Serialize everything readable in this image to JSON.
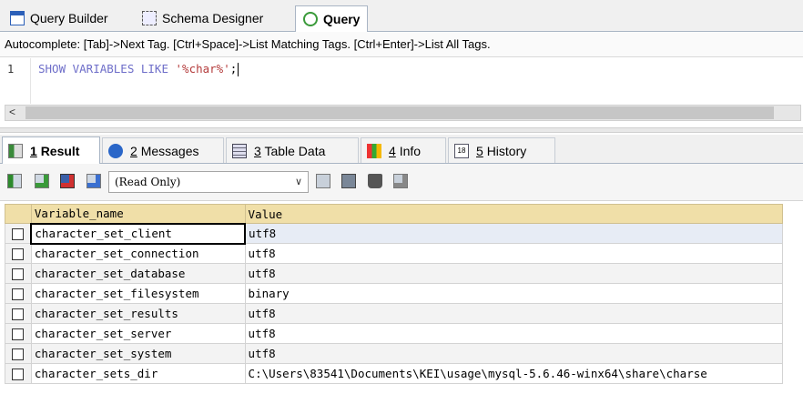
{
  "top_tabs": [
    {
      "label": "Query Builder",
      "icon": "query-builder-icon"
    },
    {
      "label": "Schema Designer",
      "icon": "schema-designer-icon"
    },
    {
      "label": "Query",
      "icon": "query-icon",
      "active": true
    }
  ],
  "hint": "Autocomplete: [Tab]->Next Tag. [Ctrl+Space]->List Matching Tags. [Ctrl+Enter]->List All Tags.",
  "editor": {
    "line_number": "1",
    "keywords": "SHOW VARIABLES LIKE ",
    "string": "'%char%'",
    "terminator": ";",
    "scroll_left": "<"
  },
  "result_tabs": [
    {
      "num": "1",
      "label": "Result",
      "icon": "result-grid-icon",
      "active": true
    },
    {
      "num": "2",
      "label": "Messages",
      "icon": "info-icon"
    },
    {
      "num": "3",
      "label": "Table Data",
      "icon": "table-icon"
    },
    {
      "num": "4",
      "label": "Info",
      "icon": "info-bars-icon"
    },
    {
      "num": "5",
      "label": "History",
      "icon": "calendar-icon",
      "badge": "18"
    }
  ],
  "toolbar": {
    "mode": "(Read Only)"
  },
  "grid": {
    "columns": [
      "Variable_name",
      "Value"
    ],
    "rows": [
      [
        "character_set_client",
        "utf8"
      ],
      [
        "character_set_connection",
        "utf8"
      ],
      [
        "character_set_database",
        "utf8"
      ],
      [
        "character_set_filesystem",
        "binary"
      ],
      [
        "character_set_results",
        "utf8"
      ],
      [
        "character_set_server",
        "utf8"
      ],
      [
        "character_set_system",
        "utf8"
      ],
      [
        "character_sets_dir",
        "C:\\Users\\83541\\Documents\\KEI\\usage\\mysql-5.6.46-winx64\\share\\charse"
      ]
    ]
  }
}
